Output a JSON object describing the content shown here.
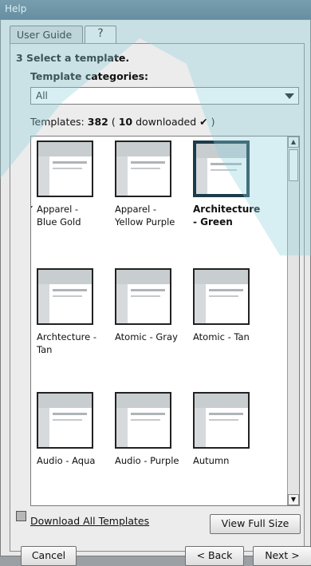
{
  "titlebar": {
    "title": "Help"
  },
  "tabs": {
    "user_guide": "User Guide",
    "help_icon": "?"
  },
  "panel": {
    "step": "3 Select a template.",
    "categories_label": "Template categories:",
    "category_selected": "All",
    "templates_prefix": "Templates:",
    "templates_total": "382",
    "templates_downloaded": "10",
    "downloaded_text": "downloaded",
    "check_glyph": "✔",
    "paren_open": "(",
    "paren_close": ")"
  },
  "templates": [
    {
      "label": "Apparel -\nBlue Gold",
      "downloaded": true,
      "selected": false
    },
    {
      "label": "Apparel -\nYellow Purple",
      "downloaded": false,
      "selected": false
    },
    {
      "label": "Architecture\n- Green",
      "downloaded": false,
      "selected": true
    },
    {
      "label": "Archtecture -\nTan",
      "downloaded": false,
      "selected": false
    },
    {
      "label": "Atomic - Gray",
      "downloaded": false,
      "selected": false
    },
    {
      "label": "Atomic - Tan",
      "downloaded": false,
      "selected": false
    },
    {
      "label": "Audio - Aqua",
      "downloaded": false,
      "selected": false
    },
    {
      "label": "Audio - Purple",
      "downloaded": false,
      "selected": false
    },
    {
      "label": "Autumn",
      "downloaded": false,
      "selected": false
    }
  ],
  "footer": {
    "download_all": "Download All Templates",
    "view_full_size": "View Full Size",
    "cancel": "Cancel",
    "back": "< Back",
    "next": "Next >"
  },
  "colors": {
    "selection_border": "#1d3b4a",
    "titlebar": "#5f778b"
  }
}
